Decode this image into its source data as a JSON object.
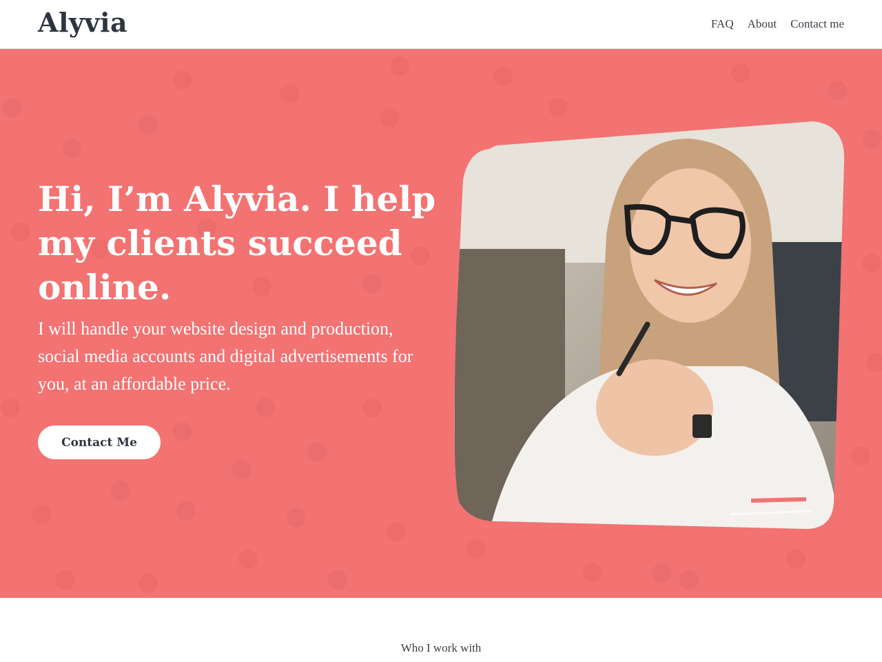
{
  "brand": {
    "logo_text": "Alyvia"
  },
  "nav": {
    "items": [
      "FAQ",
      "About",
      "Contact me"
    ]
  },
  "hero": {
    "headline": "Hi, I’m Alyvia. I help my clients succeed online.",
    "subtext": "I will handle your website design and production, social media accounts and digital advertisements for you, at an affordable price.",
    "cta_label": "Contact Me",
    "accent_color": "#f37272"
  },
  "section2": {
    "label": "Who I work with"
  },
  "icons": {
    "portrait": "portrait-photo-icon"
  }
}
